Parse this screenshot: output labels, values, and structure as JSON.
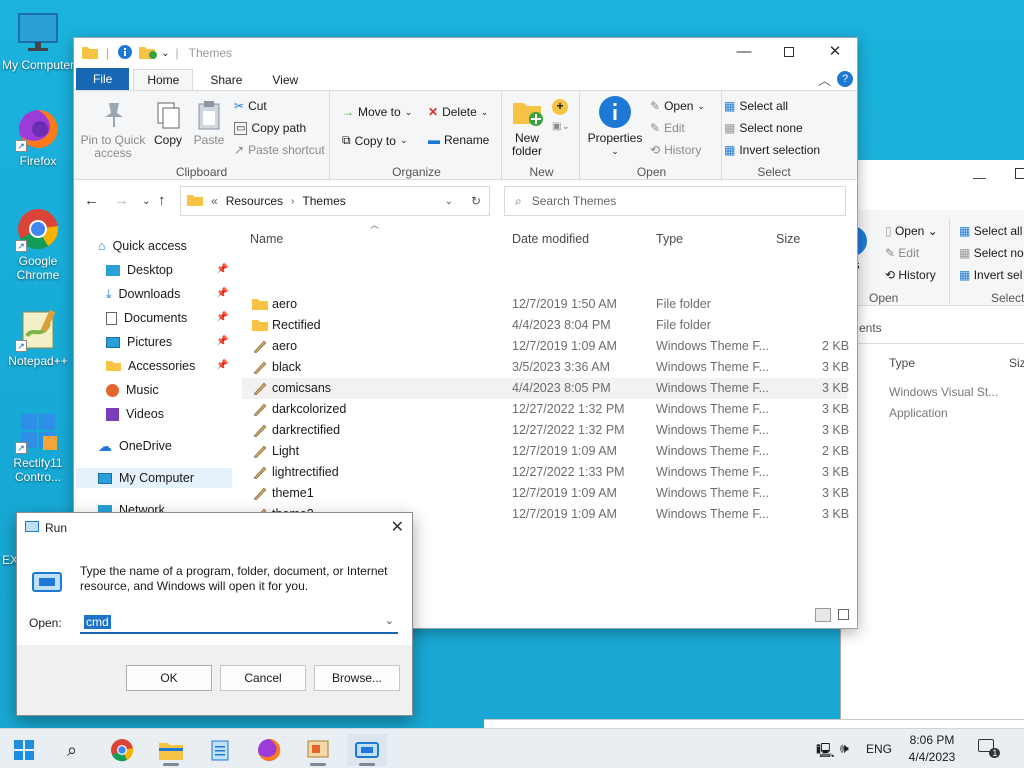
{
  "desktop": {
    "icons": [
      {
        "label": "My Computer"
      },
      {
        "label": "Firefox"
      },
      {
        "label": "Google Chrome"
      },
      {
        "label": "Notepad++"
      },
      {
        "label": "Rectify11 Contro..."
      },
      {
        "label": "EX"
      }
    ]
  },
  "explorer": {
    "title": "Themes",
    "tabs": {
      "file": "File",
      "home": "Home",
      "share": "Share",
      "view": "View"
    },
    "ribbon": {
      "clipboard": {
        "pin": "Pin to Quick access",
        "copy": "Copy",
        "paste": "Paste",
        "cut": "Cut",
        "copy_path": "Copy path",
        "paste_shortcut": "Paste shortcut",
        "label": "Clipboard"
      },
      "organize": {
        "move_to": "Move to",
        "copy_to": "Copy to",
        "delete": "Delete",
        "rename": "Rename",
        "label": "Organize"
      },
      "new": {
        "new_folder": "New folder",
        "label": "New"
      },
      "open": {
        "properties": "Properties",
        "open": "Open",
        "edit": "Edit",
        "history": "History",
        "label": "Open"
      },
      "select": {
        "select_all": "Select all",
        "select_none": "Select none",
        "invert": "Invert selection",
        "label": "Select"
      }
    },
    "breadcrumb": {
      "prefix": "«",
      "parts": [
        "Resources",
        "Themes"
      ]
    },
    "search_placeholder": "Search Themes",
    "nav": [
      {
        "label": "Quick access"
      },
      {
        "label": "Desktop"
      },
      {
        "label": "Downloads"
      },
      {
        "label": "Documents"
      },
      {
        "label": "Pictures"
      },
      {
        "label": "Accessories"
      },
      {
        "label": "Music"
      },
      {
        "label": "Videos"
      },
      {
        "label": "OneDrive"
      },
      {
        "label": "My Computer"
      },
      {
        "label": "Network"
      }
    ],
    "columns": {
      "name": "Name",
      "date": "Date modified",
      "type": "Type",
      "size": "Size"
    },
    "files": [
      {
        "name": "aero",
        "date": "12/7/2019 1:50 AM",
        "type": "File folder",
        "size": "",
        "kind": "folder"
      },
      {
        "name": "Rectified",
        "date": "4/4/2023 8:04 PM",
        "type": "File folder",
        "size": "",
        "kind": "folder"
      },
      {
        "name": "aero",
        "date": "12/7/2019 1:09 AM",
        "type": "Windows Theme F...",
        "size": "2 KB",
        "kind": "theme"
      },
      {
        "name": "black",
        "date": "3/5/2023 3:36 AM",
        "type": "Windows Theme F...",
        "size": "3 KB",
        "kind": "theme"
      },
      {
        "name": "comicsans",
        "date": "4/4/2023 8:05 PM",
        "type": "Windows Theme F...",
        "size": "3 KB",
        "kind": "theme"
      },
      {
        "name": "darkcolorized",
        "date": "12/27/2022 1:32 PM",
        "type": "Windows Theme F...",
        "size": "3 KB",
        "kind": "theme"
      },
      {
        "name": "darkrectified",
        "date": "12/27/2022 1:32 PM",
        "type": "Windows Theme F...",
        "size": "3 KB",
        "kind": "theme"
      },
      {
        "name": "Light",
        "date": "12/7/2019 1:09 AM",
        "type": "Windows Theme F...",
        "size": "2 KB",
        "kind": "theme"
      },
      {
        "name": "lightrectified",
        "date": "12/27/2022 1:33 PM",
        "type": "Windows Theme F...",
        "size": "3 KB",
        "kind": "theme"
      },
      {
        "name": "theme1",
        "date": "12/7/2019 1:09 AM",
        "type": "Windows Theme F...",
        "size": "3 KB",
        "kind": "theme"
      },
      {
        "name": "theme2",
        "date": "12/7/2019 1:09 AM",
        "type": "Windows Theme F...",
        "size": "3 KB",
        "kind": "theme"
      }
    ]
  },
  "back_window": {
    "open": "Open",
    "edit": "Edit",
    "history": "History",
    "open_label": "Open",
    "ties": "ties",
    "select_all": "Select all",
    "select_none": "Select no",
    "invert": "Invert sel",
    "select_label": "Select",
    "ents": "ents",
    "type_header": "Type",
    "size_header": "Siz",
    "rows": [
      "Windows Visual St...",
      "Application"
    ]
  },
  "run_dialog": {
    "title": "Run",
    "description": "Type the name of a program, folder, document, or Internet resource, and Windows will open it for you.",
    "open_label": "Open:",
    "value": "cmd",
    "ok": "OK",
    "cancel": "Cancel",
    "browse": "Browse..."
  },
  "taskbar": {
    "language": "ENG",
    "time": "8:06 PM",
    "date": "4/4/2023",
    "notification_count": "1"
  },
  "colors": {
    "accent": "#1767b3",
    "desktop": "#1bb3dd",
    "folder": "#f6c344"
  }
}
